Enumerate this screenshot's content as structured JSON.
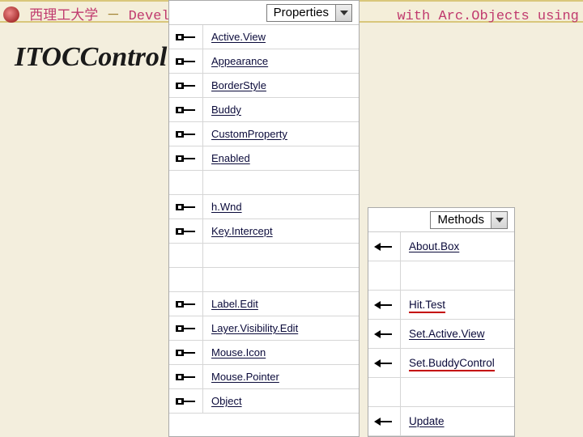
{
  "header": {
    "uni": "西理工大学",
    "dash": "－",
    "title_left": "Develop",
    "title_right": "with Arc.Objects using C#. NET"
  },
  "slide_title": "ITOCControl",
  "properties": {
    "combo": "Properties",
    "items": [
      "Active.View",
      "Appearance",
      "BorderStyle",
      "Buddy",
      "CustomProperty",
      "Enabled",
      "",
      "h.Wnd",
      "Key.Intercept",
      "",
      "",
      "Label.Edit",
      "Layer.Visibility.Edit",
      "Mouse.Icon",
      "Mouse.Pointer",
      "Object"
    ]
  },
  "methods": {
    "combo": "Methods",
    "items": [
      {
        "label": "About.Box",
        "hl": false
      },
      {
        "label": "",
        "hl": false
      },
      {
        "label": "Hit.Test",
        "hl": true
      },
      {
        "label": "Set.Active.View",
        "hl": false
      },
      {
        "label": "Set.BuddyControl",
        "hl": true
      },
      {
        "label": "",
        "hl": false
      },
      {
        "label": "Update",
        "hl": false
      }
    ]
  }
}
